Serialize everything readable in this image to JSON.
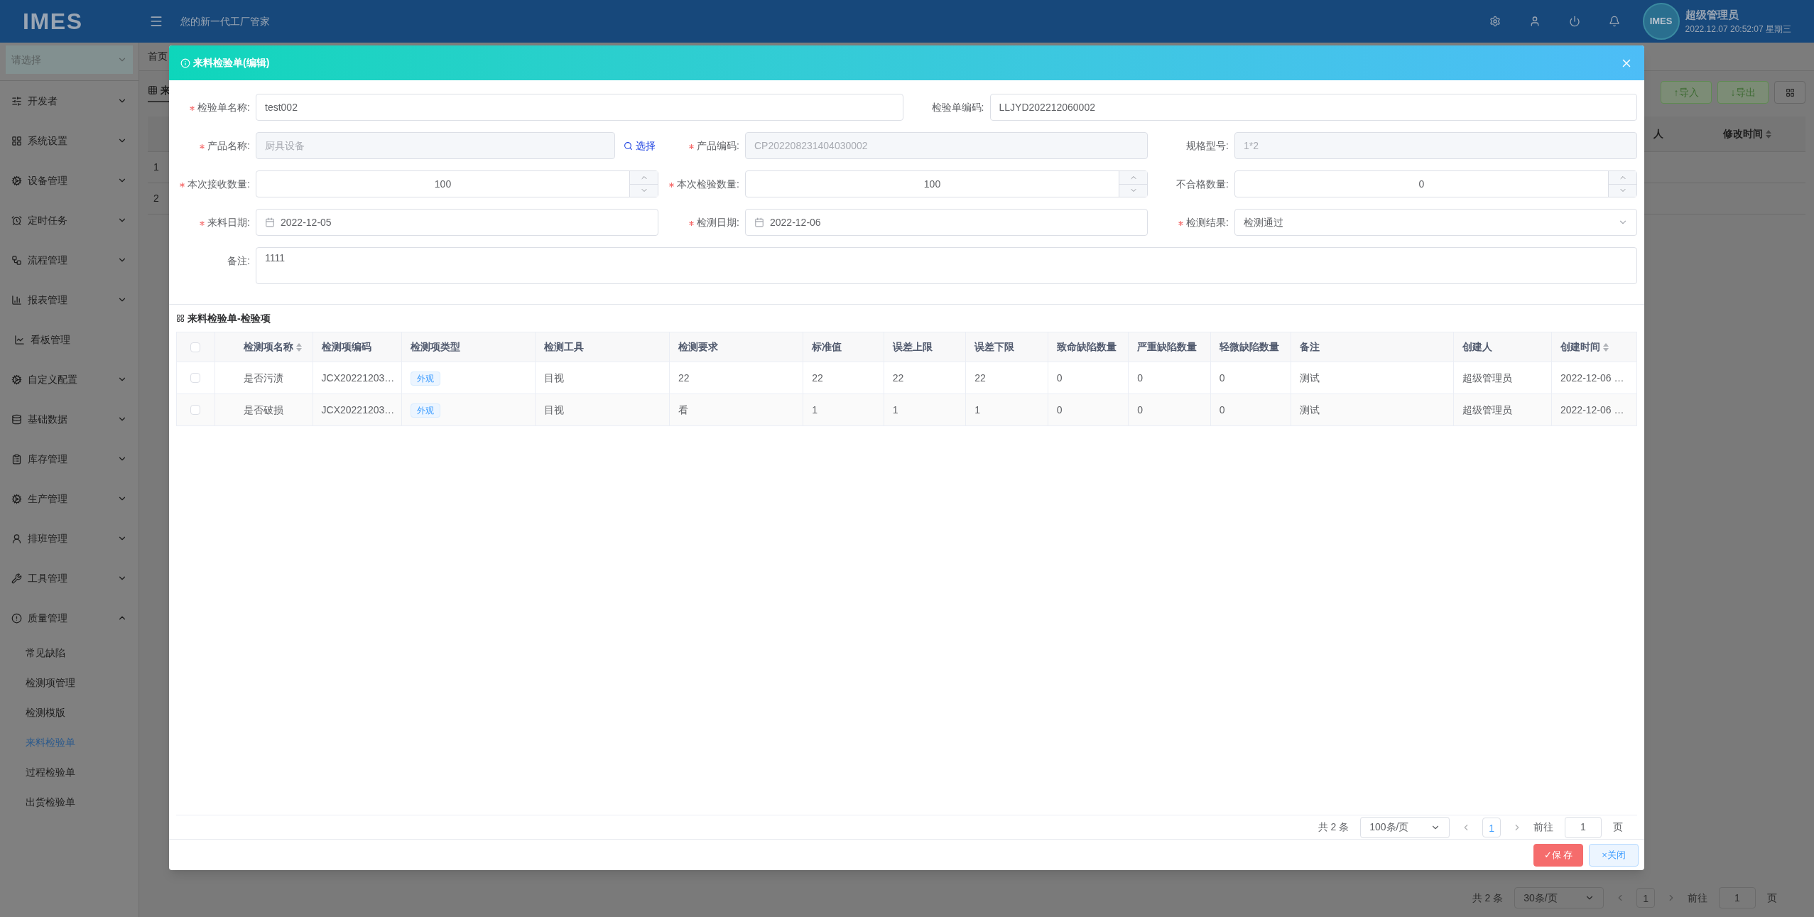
{
  "header": {
    "logo": "IMES",
    "slogan": "您的新一代工厂管家",
    "avatar_text": "IMES",
    "user": "超级管理员",
    "datetime": "2022.12.07 20:52:07 星期三"
  },
  "sidebar": {
    "select_placeholder": "请选择",
    "items": [
      {
        "label": "开发者",
        "kind": "group",
        "expanded": false
      },
      {
        "label": "系统设置",
        "kind": "group",
        "expanded": false
      },
      {
        "label": "设备管理",
        "kind": "group",
        "expanded": false
      },
      {
        "label": "定时任务",
        "kind": "group",
        "expanded": false
      },
      {
        "label": "流程管理",
        "kind": "group",
        "expanded": false
      },
      {
        "label": "报表管理",
        "kind": "group",
        "expanded": false
      },
      {
        "label": "看板管理",
        "kind": "link"
      },
      {
        "label": "自定义配置",
        "kind": "group",
        "expanded": false
      },
      {
        "label": "基础数据",
        "kind": "group",
        "expanded": false
      },
      {
        "label": "库存管理",
        "kind": "group",
        "expanded": false
      },
      {
        "label": "生产管理",
        "kind": "group",
        "expanded": false
      },
      {
        "label": "排班管理",
        "kind": "group",
        "expanded": false
      },
      {
        "label": "工具管理",
        "kind": "group",
        "expanded": false
      },
      {
        "label": "质量管理",
        "kind": "group",
        "expanded": true,
        "children": [
          {
            "label": "常见缺陷",
            "selected": false
          },
          {
            "label": "检测项管理",
            "selected": false
          },
          {
            "label": "检测模版",
            "selected": false
          },
          {
            "label": "来料检验单",
            "selected": true
          },
          {
            "label": "过程检验单",
            "selected": false
          },
          {
            "label": "出货检验单",
            "selected": false
          }
        ]
      }
    ]
  },
  "page": {
    "tabs": [
      {
        "label": "首页"
      }
    ],
    "panel_title": "来",
    "buttons": [
      "↑导入",
      "↓导出"
    ],
    "columns": [
      "人",
      "修改时间"
    ],
    "row_numbers": [
      "1",
      "2"
    ],
    "pagination": {
      "total": "共 2 条",
      "page_size": "30条/页",
      "page": "1",
      "goto": "前往",
      "goto_value": "1",
      "page_unit": "页"
    }
  },
  "dialog": {
    "title": "来料检验单(编辑)",
    "form_rows": [
      [
        {
          "label": "检验单名称:",
          "required": true,
          "kind": "text",
          "value": "test002",
          "disabled": false
        },
        {
          "label": "检验单编码:",
          "required": false,
          "kind": "text",
          "value": "LLJYD202212060002",
          "disabled": false
        }
      ],
      [
        {
          "label": "产品名称:",
          "required": true,
          "kind": "picker",
          "value": "厨具设备",
          "disabled": true,
          "action": "选择"
        },
        {
          "label": "产品编码:",
          "required": true,
          "kind": "text",
          "value": "CP202208231404030002",
          "disabled": true
        },
        {
          "label": "规格型号:",
          "required": false,
          "kind": "text",
          "value": "1*2",
          "disabled": true
        }
      ],
      [
        {
          "label": "本次接收数量:",
          "required": true,
          "kind": "number",
          "value": "100",
          "disabled": false
        },
        {
          "label": "本次检验数量:",
          "required": true,
          "kind": "number",
          "value": "100",
          "disabled": false
        },
        {
          "label": "不合格数量:",
          "required": false,
          "kind": "number",
          "value": "0",
          "disabled": false
        }
      ],
      [
        {
          "label": "来料日期:",
          "required": true,
          "kind": "date",
          "value": "2022-12-05",
          "disabled": false
        },
        {
          "label": "检测日期:",
          "required": true,
          "kind": "date",
          "value": "2022-12-06",
          "disabled": false
        },
        {
          "label": "检测结果:",
          "required": true,
          "kind": "select",
          "value": "检测通过",
          "disabled": false
        }
      ],
      [
        {
          "label": "备注:",
          "required": false,
          "kind": "textarea",
          "value": "1111",
          "disabled": false
        }
      ]
    ],
    "table": {
      "title": "来料检验单-检验项",
      "select_all_checked": false,
      "columns": [
        {
          "label": "检测项名称",
          "sortable": true
        },
        {
          "label": "检测项编码",
          "sortable": false
        },
        {
          "label": "检测项类型",
          "sortable": false
        },
        {
          "label": "检测工具",
          "sortable": false
        },
        {
          "label": "检测要求",
          "sortable": false
        },
        {
          "label": "标准值",
          "sortable": false
        },
        {
          "label": "误差上限",
          "sortable": false
        },
        {
          "label": "误差下限",
          "sortable": false
        },
        {
          "label": "致命缺陷数量",
          "sortable": false
        },
        {
          "label": "严重缺陷数量",
          "sortable": false
        },
        {
          "label": "轻微缺陷数量",
          "sortable": false
        },
        {
          "label": "备注",
          "sortable": false
        },
        {
          "label": "创建人",
          "sortable": false
        },
        {
          "label": "创建时间",
          "sortable": true
        }
      ],
      "rows": [
        {
          "checked": false,
          "cells": [
            "是否污渍",
            "JCX20221203…",
            "外观",
            "目视",
            "22",
            "22",
            "22",
            "22",
            "0",
            "0",
            "0",
            "测试",
            "超级管理员",
            "2022-12-06 …"
          ]
        },
        {
          "checked": false,
          "cells": [
            "是否破损",
            "JCX20221203…",
            "外观",
            "目视",
            "看",
            "1",
            "1",
            "1",
            "0",
            "0",
            "0",
            "测试",
            "超级管理员",
            "2022-12-06 …"
          ]
        }
      ],
      "pagination": {
        "total": "共 2 条",
        "page_size": "100条/页",
        "page": "1",
        "goto": "前往",
        "goto_value": "1",
        "page_unit": "页"
      }
    },
    "buttons": [
      {
        "label": "✓保 存",
        "kind": "primary"
      },
      {
        "label": "×关闭",
        "kind": "secondary"
      }
    ]
  }
}
